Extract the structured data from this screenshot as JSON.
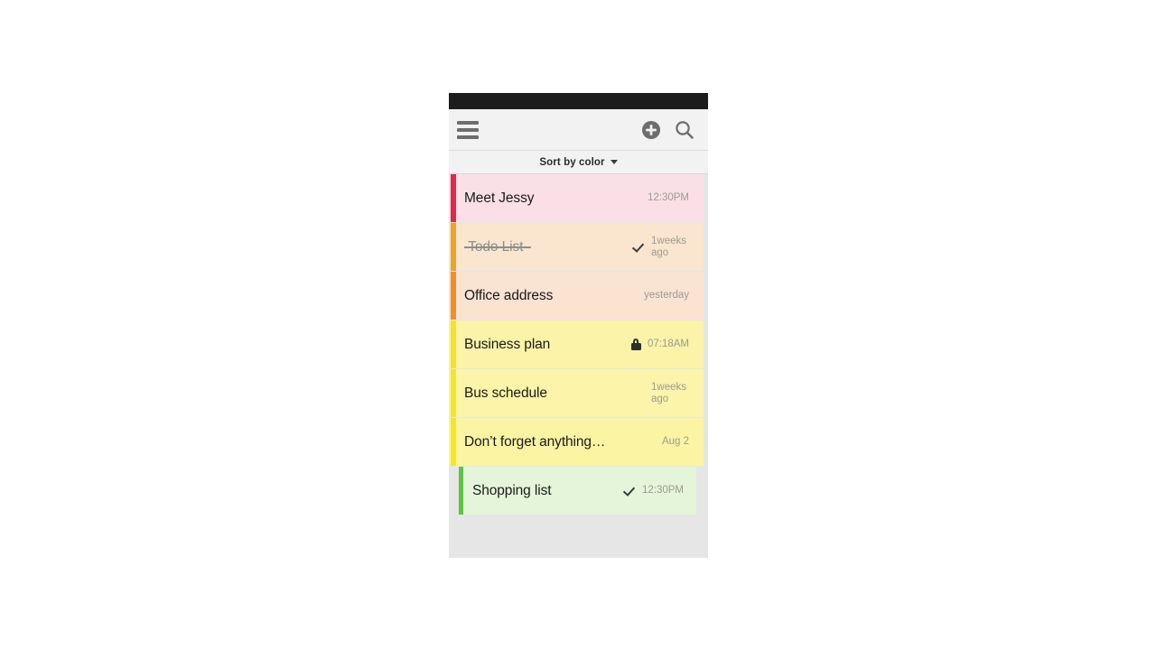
{
  "app": {
    "statusbar_color": "#1c1c1c",
    "toolbar_bg": "#f2f2f2",
    "list_bg": "#e6e6e6"
  },
  "toolbar": {
    "menu_icon": "hamburger-menu-icon",
    "add_icon": "plus-circle-icon",
    "search_icon": "search-icon"
  },
  "sortbar": {
    "label": "Sort by color",
    "caret_icon": "chevron-down-icon"
  },
  "notes": [
    {
      "title": "Meet Jessy",
      "time": "12:30PM",
      "bar_color": "#e0294b",
      "bg_color": "#fae0e6",
      "done": false,
      "locked": false,
      "wrap": false,
      "inset": false
    },
    {
      "title": "Todo List",
      "time": "1weeks ago",
      "bar_color": "#eda22a",
      "bg_color": "#fae5ce",
      "done": true,
      "locked": false,
      "wrap": true,
      "inset": false
    },
    {
      "title": "Office address",
      "time": "yesterday",
      "bar_color": "#ef8f2a",
      "bg_color": "#fbe3d2",
      "done": false,
      "locked": false,
      "wrap": false,
      "inset": false
    },
    {
      "title": "Business plan",
      "time": "07:18AM",
      "bar_color": "#f2e228",
      "bg_color": "#fbf3a8",
      "done": false,
      "locked": true,
      "wrap": false,
      "inset": false
    },
    {
      "title": "Bus schedule",
      "time": "1weeks ago",
      "bar_color": "#f3e52b",
      "bg_color": "#fbf4a9",
      "done": false,
      "locked": false,
      "wrap": true,
      "inset": false
    },
    {
      "title": "Don’t forget anything…",
      "time": "Aug 2",
      "bar_color": "#f5e622",
      "bg_color": "#fbf4a2",
      "done": false,
      "locked": false,
      "wrap": false,
      "inset": false
    },
    {
      "title": "Shopping list",
      "time": "12:30PM",
      "bar_color": "#59c640",
      "bg_color": "#e4f5da",
      "done": false,
      "locked": false,
      "wrap": false,
      "inset": true,
      "checked": true
    }
  ]
}
